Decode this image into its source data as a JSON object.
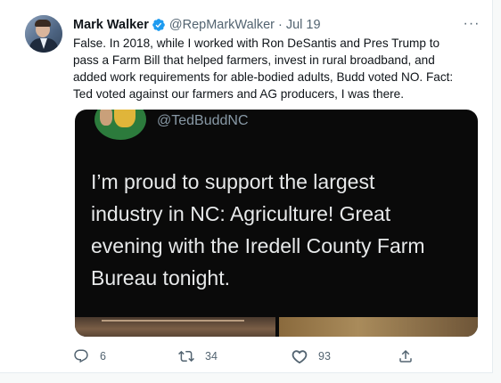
{
  "tweet": {
    "author_name": "Mark Walker",
    "handle": "@RepMarkWalker",
    "separator": "·",
    "date": "Jul 19",
    "more_label": "···",
    "text_lines": [
      "False. In 2018, while I worked with Ron DeSantis and Pres Trump to",
      "pass a Farm Bill that helped farmers, invest in rural broadband, and",
      "added work requirements for able-bodied adults, Budd voted NO. Fact:",
      "Ted voted against our farmers and AG producers, I was there."
    ]
  },
  "embedded": {
    "handle": "@TedBuddNC",
    "text_lines": [
      "I’m proud to support the largest",
      "industry in NC: Agriculture! Great",
      "evening with the Iredell County Farm",
      "Bureau tonight."
    ]
  },
  "actions": {
    "reply_count": "6",
    "retweet_count": "34",
    "like_count": "93"
  },
  "colors": {
    "verified": "#1d9bf0",
    "text": "#0f1419",
    "secondary": "#536471",
    "media_bg": "#0a0a0a"
  },
  "icons": [
    "verified-badge-icon",
    "more-icon",
    "reply-icon",
    "retweet-icon",
    "like-icon",
    "share-icon"
  ]
}
